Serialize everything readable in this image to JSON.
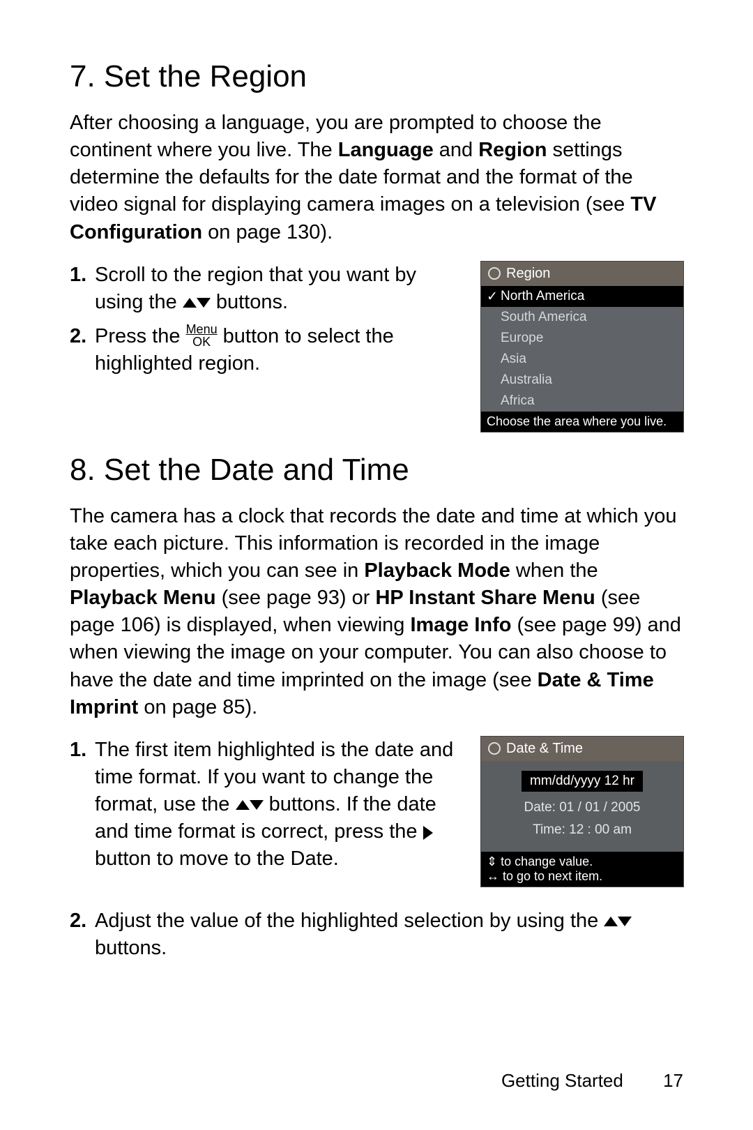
{
  "section7": {
    "heading": "7.   Set the Region",
    "intro_a": "After choosing a language, you are prompted to choose the continent where you live. The ",
    "intro_b": "Language",
    "intro_c": " and ",
    "intro_d": "Region",
    "intro_e": " settings determine the defaults for the date format and the format of the video signal for displaying camera images on a television (see ",
    "intro_f": "TV Configuration",
    "intro_g": " on page 130).",
    "step1_a": "Scroll to the region that you want by using the ",
    "step1_b": " buttons.",
    "step2_a": "Press the ",
    "step2_b": " button to select the highlighted region.",
    "menu_label_top": "Menu",
    "menu_label_bot": "OK"
  },
  "lcd_region": {
    "title": "Region",
    "items": [
      "North America",
      "South America",
      "Europe",
      "Asia",
      "Australia",
      "Africa"
    ],
    "selected_index": 0,
    "footer": "Choose the area where you live."
  },
  "section8": {
    "heading": "8.   Set the Date and Time",
    "intro_a": "The camera has a clock that records the date and time at which you take each picture. This information is recorded in the image properties, which you can see in ",
    "intro_b": "Playback Mode",
    "intro_c": " when the ",
    "intro_d": "Playback Menu",
    "intro_e": " (see page 93) or ",
    "intro_f": "HP Instant Share Menu",
    "intro_g": " (see page 106) is displayed, when viewing ",
    "intro_h": "Image Info",
    "intro_i": " (see page 99) and when viewing the image on your computer. You can also choose to have the date and time imprinted on the image (see ",
    "intro_j": "Date & Time Imprint",
    "intro_k": " on page 85).",
    "step1_a": "The first item highlighted is the date and time format. If you want to change the format, use the ",
    "step1_b": " buttons. If the date and time format is correct, press the ",
    "step1_c": " button to move to the Date.",
    "step2_a": "Adjust the value of the highlighted selection by using the ",
    "step2_b": " buttons."
  },
  "lcd_datetime": {
    "title": "Date & Time",
    "format": "mm/dd/yyyy  12 hr",
    "date_line": "Date:  01 / 01 / 2005",
    "time_line": "Time:  12 : 00  am",
    "footer1": "to change value.",
    "footer2": "to go to next item."
  },
  "footer": {
    "section": "Getting Started",
    "page": "17"
  }
}
